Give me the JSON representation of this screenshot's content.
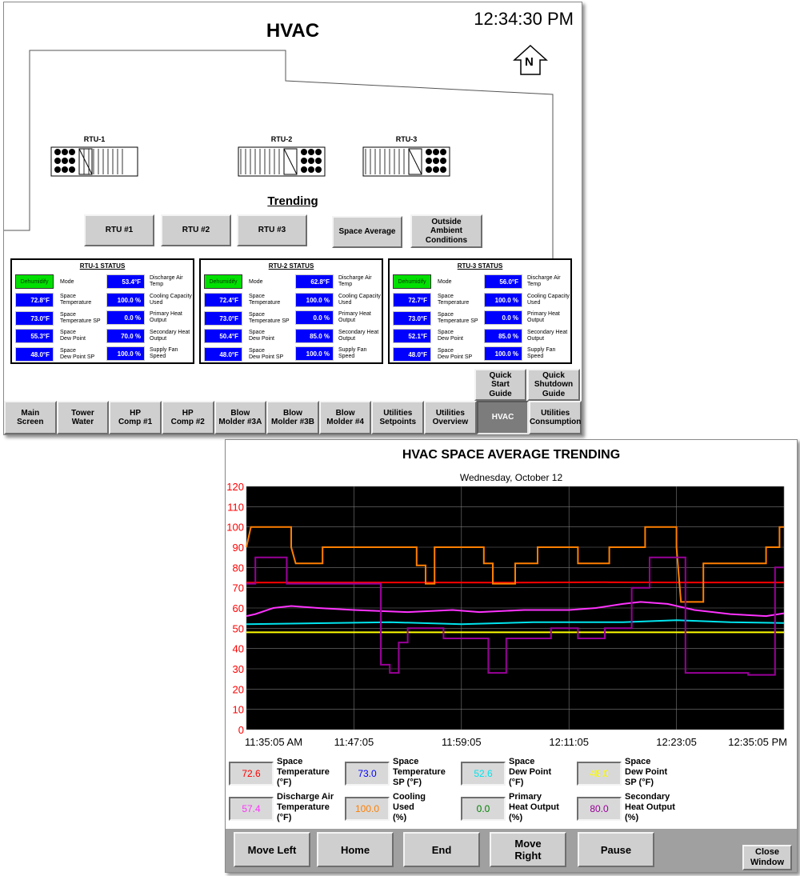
{
  "hvac_window": {
    "title": "HVAC",
    "clock": "12:34:30 PM",
    "north_label": "N",
    "units": [
      "RTU-1",
      "RTU-2",
      "RTU-3"
    ],
    "trending_heading": "Trending",
    "trending_buttons": [
      "RTU #1",
      "RTU #2",
      "RTU #3",
      "Space Average",
      "Outside\nAmbient\nConditions"
    ],
    "status_panels": [
      {
        "title": "RTU-1 STATUS",
        "mode_value": "Dehumidify",
        "mode_label": "Mode",
        "left_values": [
          "72.8°F",
          "73.0°F",
          "55.3°F",
          "48.0°F"
        ],
        "left_labels": [
          "Space\nTemperature",
          "Space\nTemperature SP",
          "Space\nDew Point",
          "Space\nDew Point SP"
        ],
        "right_values": [
          "53.4°F",
          "100.0 %",
          "0.0 %",
          "70.0 %",
          "100.0 %"
        ],
        "right_labels": [
          "Discharge Air\nTemp",
          "Cooling Capacity\nUsed",
          "Primary Heat\nOutput",
          "Secondary Heat\nOutput",
          "Supply Fan\nSpeed"
        ]
      },
      {
        "title": "RTU-2 STATUS",
        "mode_value": "Dehumidify",
        "mode_label": "Mode",
        "left_values": [
          "72.4°F",
          "73.0°F",
          "50.4°F",
          "48.0°F"
        ],
        "left_labels": [
          "Space\nTemperature",
          "Space\nTemperature SP",
          "Space\nDew Point",
          "Space\nDew Point SP"
        ],
        "right_values": [
          "62.8°F",
          "100.0 %",
          "0.0 %",
          "85.0 %",
          "100.0 %"
        ],
        "right_labels": [
          "Discharge Air\nTemp",
          "Cooling Capacity\nUsed",
          "Primary Heat\nOutput",
          "Secondary Heat\nOutput",
          "Supply Fan\nSpeed"
        ]
      },
      {
        "title": "RTU-3 STATUS",
        "mode_value": "Dehumidify",
        "mode_label": "Mode",
        "left_values": [
          "72.7°F",
          "73.0°F",
          "52.1°F",
          "48.0°F"
        ],
        "left_labels": [
          "Space\nTemperature",
          "Space\nTemperature SP",
          "Space\nDew Point",
          "Space\nDew Point SP"
        ],
        "right_values": [
          "56.0°F",
          "100.0 %",
          "0.0 %",
          "85.0 %",
          "100.0 %"
        ],
        "right_labels": [
          "Discharge Air\nTemp",
          "Cooling Capacity\nUsed",
          "Primary Heat\nOutput",
          "Secondary Heat\nOutput",
          "Supply Fan\nSpeed"
        ]
      }
    ],
    "guide_buttons": [
      "Quick\nStart\nGuide",
      "Quick\nShutdown\nGuide"
    ],
    "nav_tabs": [
      "Main\nScreen",
      "Tower\nWater",
      "HP\nComp #1",
      "HP\nComp #2",
      "Blow\nMolder #3A",
      "Blow\nMolder #3B",
      "Blow\nMolder #4",
      "Utilities\nSetpoints",
      "Utilities\nOverview",
      "HVAC",
      "Utilities\nConsumption"
    ],
    "active_tab": "HVAC"
  },
  "trend_window": {
    "title": "HVAC SPACE AVERAGE TRENDING",
    "date": "Wednesday, October 12",
    "legend": [
      {
        "value": "72.6",
        "label": "Space\nTemperature\n(°F)",
        "color": "#ff0000"
      },
      {
        "value": "73.0",
        "label": "Space\nTemperature\nSP (°F)",
        "color": "#0000ff"
      },
      {
        "value": "52.6",
        "label": "Space\nDew Point\n(°F)",
        "color": "#00e5ee"
      },
      {
        "value": "48.0",
        "label": "Space\nDew Point\nSP (°F)",
        "color": "#ffff00"
      },
      {
        "value": "57.4",
        "label": "Discharge Air\nTemperature\n(°F)",
        "color": "#ff33ff"
      },
      {
        "value": "100.0",
        "label": "Cooling\nUsed\n(%)",
        "color": "#ff7f00"
      },
      {
        "value": "0.0",
        "label": "Primary\nHeat Output\n(%)",
        "color": "#008000"
      },
      {
        "value": "80.0",
        "label": "Secondary\nHeat Output\n(%)",
        "color": "#990099"
      }
    ],
    "controls": [
      "Move Left",
      "Home",
      "End",
      "Move\nRight",
      "Pause"
    ],
    "close_button": "Close\nWindow"
  },
  "chart_data": {
    "type": "line",
    "title": "HVAC SPACE AVERAGE TRENDING",
    "subtitle": "Wednesday, October 12",
    "x_ticks": [
      "11:35:05 AM",
      "11:47:05",
      "11:59:05",
      "12:11:05",
      "12:23:05",
      "12:35:05 PM"
    ],
    "x_range_minutes": [
      0,
      60
    ],
    "y_ticks": [
      0,
      10,
      20,
      30,
      40,
      50,
      60,
      70,
      80,
      90,
      100,
      110,
      120
    ],
    "ylim": [
      0,
      120
    ],
    "grid": true,
    "background": "#000000",
    "series": [
      {
        "name": "Space Temperature (°F)",
        "color": "#ff0000",
        "points": [
          [
            0,
            72.5
          ],
          [
            10,
            72.6
          ],
          [
            20,
            72.6
          ],
          [
            30,
            72.5
          ],
          [
            40,
            72.7
          ],
          [
            50,
            72.6
          ],
          [
            60,
            72.6
          ]
        ]
      },
      {
        "name": "Space Dew Point (°F)",
        "color": "#00e5ee",
        "points": [
          [
            0,
            52
          ],
          [
            8,
            52.5
          ],
          [
            16,
            53
          ],
          [
            24,
            52
          ],
          [
            32,
            53
          ],
          [
            42,
            53
          ],
          [
            48,
            54
          ],
          [
            54,
            53
          ],
          [
            60,
            52.6
          ]
        ]
      },
      {
        "name": "Space Dew Point SP (°F)",
        "color": "#ffff00",
        "points": [
          [
            0,
            48
          ],
          [
            60,
            48
          ]
        ]
      },
      {
        "name": "Discharge Air Temperature (°F)",
        "color": "#ff33ff",
        "points": [
          [
            0,
            56
          ],
          [
            1,
            57
          ],
          [
            3,
            60
          ],
          [
            5,
            61
          ],
          [
            8,
            60
          ],
          [
            12,
            59
          ],
          [
            18,
            58
          ],
          [
            23,
            59
          ],
          [
            26,
            58
          ],
          [
            31,
            59
          ],
          [
            36,
            59
          ],
          [
            39,
            60
          ],
          [
            42,
            62
          ],
          [
            44,
            63
          ],
          [
            47,
            62
          ],
          [
            50,
            59
          ],
          [
            54,
            57
          ],
          [
            58,
            56
          ],
          [
            60,
            57.4
          ]
        ]
      },
      {
        "name": "Cooling Used (%)",
        "color": "#ff7f00",
        "points": [
          [
            0,
            90
          ],
          [
            0.5,
            100
          ],
          [
            5,
            100
          ],
          [
            5,
            90
          ],
          [
            5.5,
            82
          ],
          [
            8.5,
            82
          ],
          [
            8.5,
            90
          ],
          [
            19,
            90
          ],
          [
            19,
            81
          ],
          [
            20,
            81
          ],
          [
            20,
            72
          ],
          [
            21,
            72
          ],
          [
            21,
            90
          ],
          [
            26.5,
            90
          ],
          [
            26.5,
            82
          ],
          [
            27.5,
            82
          ],
          [
            27.5,
            72
          ],
          [
            30,
            72
          ],
          [
            30,
            82
          ],
          [
            32.5,
            82
          ],
          [
            32.5,
            90
          ],
          [
            37,
            90
          ],
          [
            37,
            82
          ],
          [
            40.5,
            82
          ],
          [
            40.5,
            90
          ],
          [
            44.5,
            90
          ],
          [
            44.5,
            100
          ],
          [
            48,
            100
          ],
          [
            48,
            90
          ],
          [
            48.5,
            63
          ],
          [
            51,
            63
          ],
          [
            51,
            82
          ],
          [
            58,
            82
          ],
          [
            58,
            90
          ],
          [
            59.5,
            90
          ],
          [
            59.5,
            100
          ],
          [
            60,
            100
          ]
        ]
      },
      {
        "name": "Secondary Heat Output (%)",
        "color": "#990099",
        "points": [
          [
            0,
            72
          ],
          [
            1,
            72
          ],
          [
            1,
            85
          ],
          [
            4.5,
            85
          ],
          [
            4.5,
            72
          ],
          [
            15,
            72
          ],
          [
            15,
            32
          ],
          [
            16,
            32
          ],
          [
            16,
            28
          ],
          [
            17,
            28
          ],
          [
            17,
            43
          ],
          [
            18,
            43
          ],
          [
            18,
            50
          ],
          [
            22,
            50
          ],
          [
            22,
            45
          ],
          [
            27,
            45
          ],
          [
            27,
            28
          ],
          [
            29,
            28
          ],
          [
            29,
            45
          ],
          [
            34,
            45
          ],
          [
            34,
            50
          ],
          [
            37,
            50
          ],
          [
            37,
            45
          ],
          [
            40,
            45
          ],
          [
            40,
            50
          ],
          [
            43,
            50
          ],
          [
            43,
            70
          ],
          [
            45,
            70
          ],
          [
            45,
            85
          ],
          [
            49,
            85
          ],
          [
            49,
            28
          ],
          [
            56,
            28
          ],
          [
            56,
            27
          ],
          [
            59,
            27
          ],
          [
            59,
            80
          ],
          [
            60,
            80
          ]
        ]
      }
    ]
  }
}
